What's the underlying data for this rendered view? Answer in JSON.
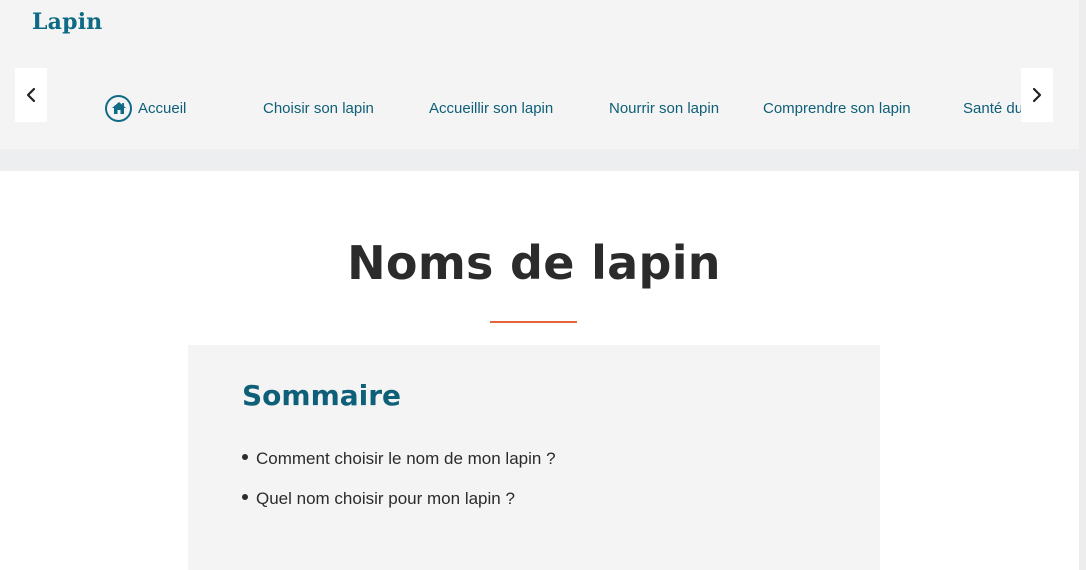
{
  "site": {
    "logo": "Lapin"
  },
  "nav": {
    "items": [
      {
        "label": "Accueil",
        "icon": "home-icon"
      },
      {
        "label": "Choisir son lapin"
      },
      {
        "label": "Accueillir son lapin"
      },
      {
        "label": "Nourrir son lapin"
      },
      {
        "label": "Comprendre son lapin"
      },
      {
        "label": "Santé du lapin"
      }
    ],
    "prev_icon": "chevron-left-icon",
    "next_icon": "chevron-right-icon"
  },
  "page": {
    "title": "Noms de lapin"
  },
  "toc": {
    "title": "Sommaire",
    "items": [
      "Comment choisir le nom de mon lapin ?",
      "Quel nom choisir pour mon lapin ?"
    ]
  },
  "colors": {
    "brand": "#0e6a85",
    "accent_rule": "#e4643b",
    "header_bg": "#f4f4f4",
    "text": "#2b2b2b"
  }
}
